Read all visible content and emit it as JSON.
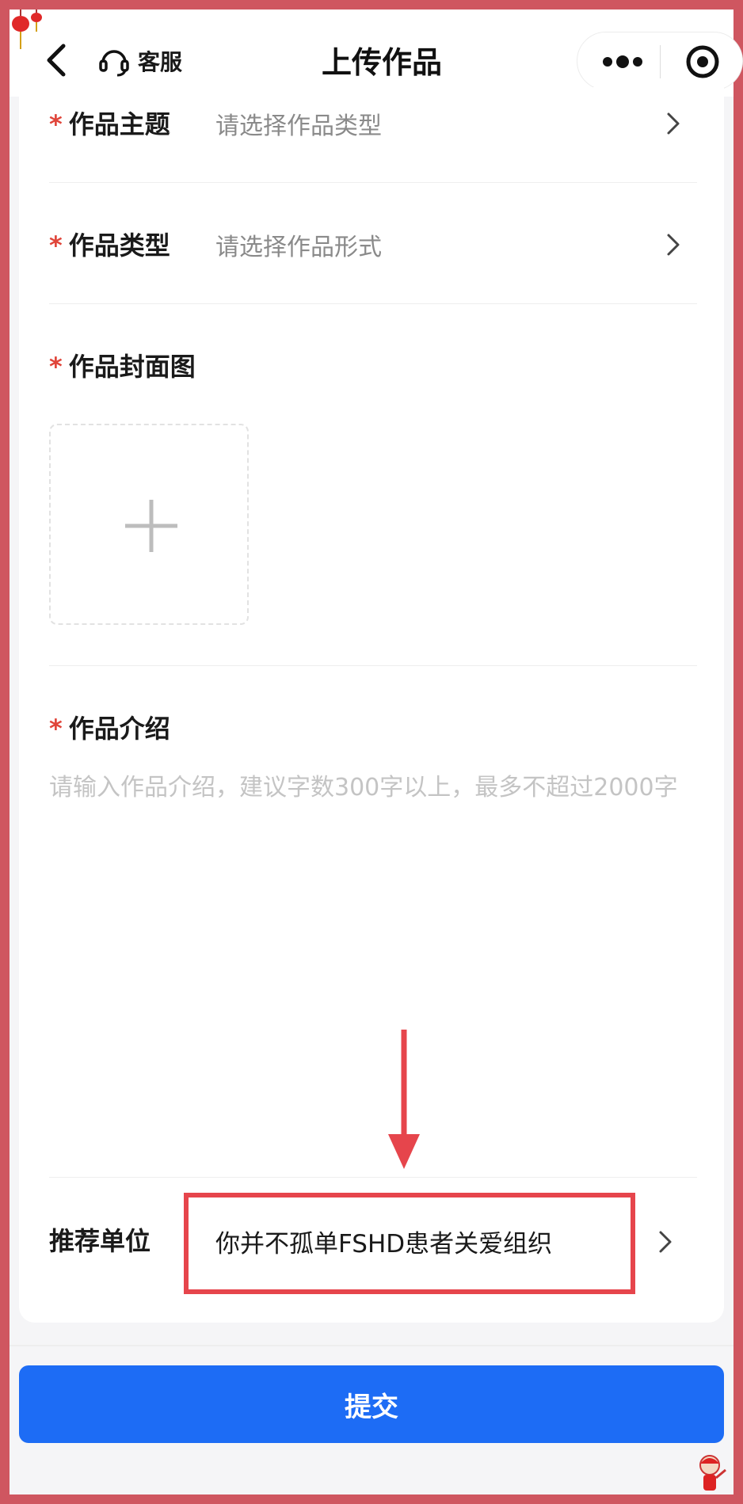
{
  "nav": {
    "title": "上传作品",
    "customer_service": "客服"
  },
  "form": {
    "required_mark": "*",
    "theme": {
      "label": "作品主题",
      "placeholder": "请选择作品类型"
    },
    "type": {
      "label": "作品类型",
      "placeholder": "请选择作品形式"
    },
    "cover": {
      "label": "作品封面图"
    },
    "intro": {
      "label": "作品介绍",
      "placeholder": "请输入作品介绍，建议字数300字以上，最多不超过2000字"
    },
    "recommend": {
      "label": "推荐单位",
      "value": "你并不孤单FSHD患者关爱组织"
    }
  },
  "submit_label": "提交",
  "colors": {
    "frame": "#cf5660",
    "required": "#e0453a",
    "highlight": "#e6454c",
    "primary": "#1d6cf5"
  },
  "icons": [
    "back-icon",
    "headset-icon",
    "more-icon",
    "close-target-icon",
    "chevron-right-icon",
    "plus-icon",
    "arrow-down-icon"
  ]
}
